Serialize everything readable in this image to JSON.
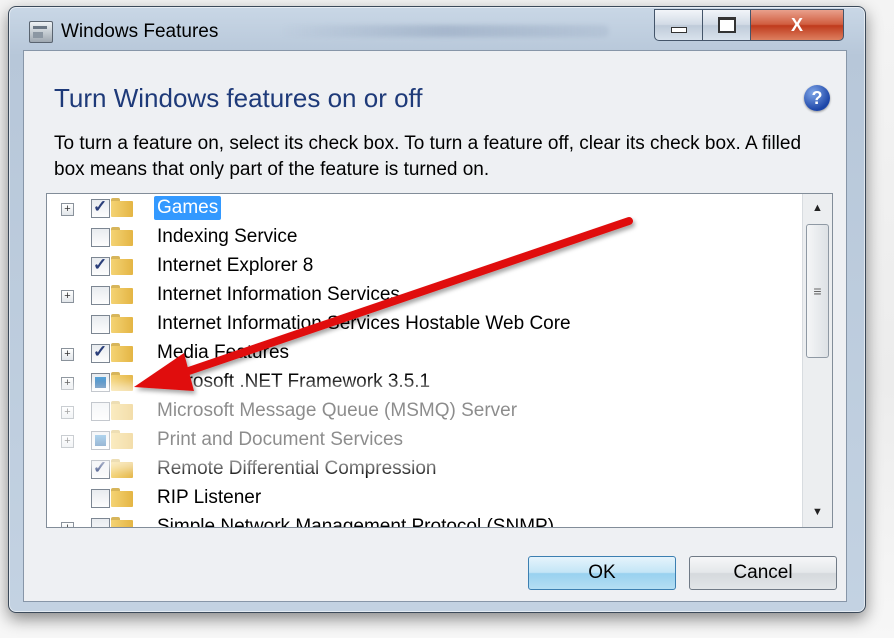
{
  "window": {
    "title": "Windows Features",
    "close_glyph": "X"
  },
  "dialog": {
    "heading": "Turn Windows features on or off",
    "description": "To turn a feature on, select its check box. To turn a feature off, clear its check box. A filled box means that only part of the feature is turned on.",
    "help_glyph": "?"
  },
  "features": [
    {
      "label": "Games",
      "state": "checked",
      "expandable": true,
      "selected": true
    },
    {
      "label": "Indexing Service",
      "state": "unchecked",
      "expandable": false,
      "selected": false
    },
    {
      "label": "Internet Explorer 8",
      "state": "checked",
      "expandable": false,
      "selected": false
    },
    {
      "label": "Internet Information Services",
      "state": "unchecked",
      "expandable": true,
      "selected": false
    },
    {
      "label": "Internet Information Services Hostable Web Core",
      "state": "unchecked",
      "expandable": false,
      "selected": false
    },
    {
      "label": "Media Features",
      "state": "checked",
      "expandable": true,
      "selected": false
    },
    {
      "label": "Microsoft .NET Framework 3.5.1",
      "state": "partial",
      "expandable": true,
      "selected": false
    },
    {
      "label": "Microsoft Message Queue (MSMQ) Server",
      "state": "unchecked",
      "expandable": true,
      "selected": false
    },
    {
      "label": "Print and Document Services",
      "state": "partial",
      "expandable": true,
      "selected": false
    },
    {
      "label": "Remote Differential Compression",
      "state": "checked",
      "expandable": false,
      "selected": false
    },
    {
      "label": "RIP Listener",
      "state": "unchecked",
      "expandable": false,
      "selected": false
    },
    {
      "label": "Simple Network Management Protocol (SNMP)",
      "state": "unchecked",
      "expandable": true,
      "selected": false
    }
  ],
  "buttons": {
    "ok": "OK",
    "cancel": "Cancel"
  },
  "colors": {
    "heading": "#1e3a79",
    "selection": "#3399ff",
    "annotation_arrow": "#e01010"
  },
  "icons": {
    "expander": "plus-box-icon",
    "folder": "folder-icon",
    "help": "help-icon"
  }
}
